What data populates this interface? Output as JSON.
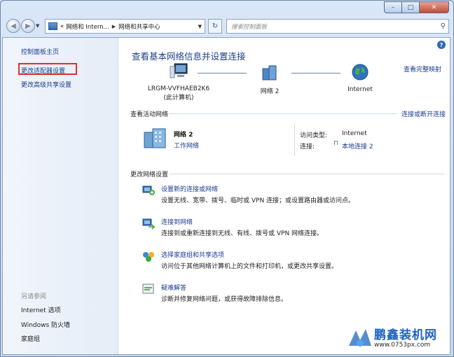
{
  "window": {
    "minimize": "–",
    "maximize": "□",
    "close": "✕"
  },
  "nav": {
    "back": "◀",
    "forward": "▶",
    "recent": "▼",
    "address_prefix": "«",
    "address_part1": "网络和 Intern...",
    "address_sep": "▶",
    "address_part2": "网络和共享中心",
    "address_dropdown": "▼",
    "refresh": "↻",
    "search_placeholder": "搜索控制面板",
    "search_icon": "⚲"
  },
  "sidebar": {
    "home": "控制面板主页",
    "adapter": "更改适配器设置",
    "advanced": "更改高级共享设置",
    "see_also": "另请参阅",
    "internet_options": "Internet 选项",
    "firewall": "Windows 防火墙",
    "homegroup": "家庭组"
  },
  "main": {
    "help": "?",
    "title": "查看基本网络信息并设置连接",
    "full_map": "查看完整映射",
    "computer_name": "LRGM-VVFHAEB2K6",
    "computer_sub": "(此计算机)",
    "network_label": "网络  2",
    "internet_label": "Internet",
    "active_header": "查看活动网络",
    "connect_disconnect": "连接或断开连接",
    "active_name": "网络  2",
    "active_type": "工作网络",
    "access_type_label": "访问类型:",
    "access_type_value": "Internet",
    "connection_label": "连接:",
    "connection_value": "本地连接 2",
    "change_header": "更改网络设置",
    "tasks": [
      {
        "link": "设置新的连接或网络",
        "desc": "设置无线、宽带、拨号、临时或 VPN 连接；或设置路由器或访问点。"
      },
      {
        "link": "连接到网络",
        "desc": "连接到或重新连接到无线、有线、拨号或 VPN 网络连接。"
      },
      {
        "link": "选择家庭组和共享选项",
        "desc": "访问位于其他网络计算机上的文件和打印机，或更改共享设置。"
      },
      {
        "link": "疑难解答",
        "desc": "诊断并修复网络问题，或获得故障排除信息。"
      }
    ]
  },
  "watermark": {
    "brand": "鹏鑫装机网",
    "url": "www.0753px.com"
  },
  "colors": {
    "link": "#1a3d8f",
    "highlight": "#e0302a",
    "title": "#1e3f8a"
  }
}
